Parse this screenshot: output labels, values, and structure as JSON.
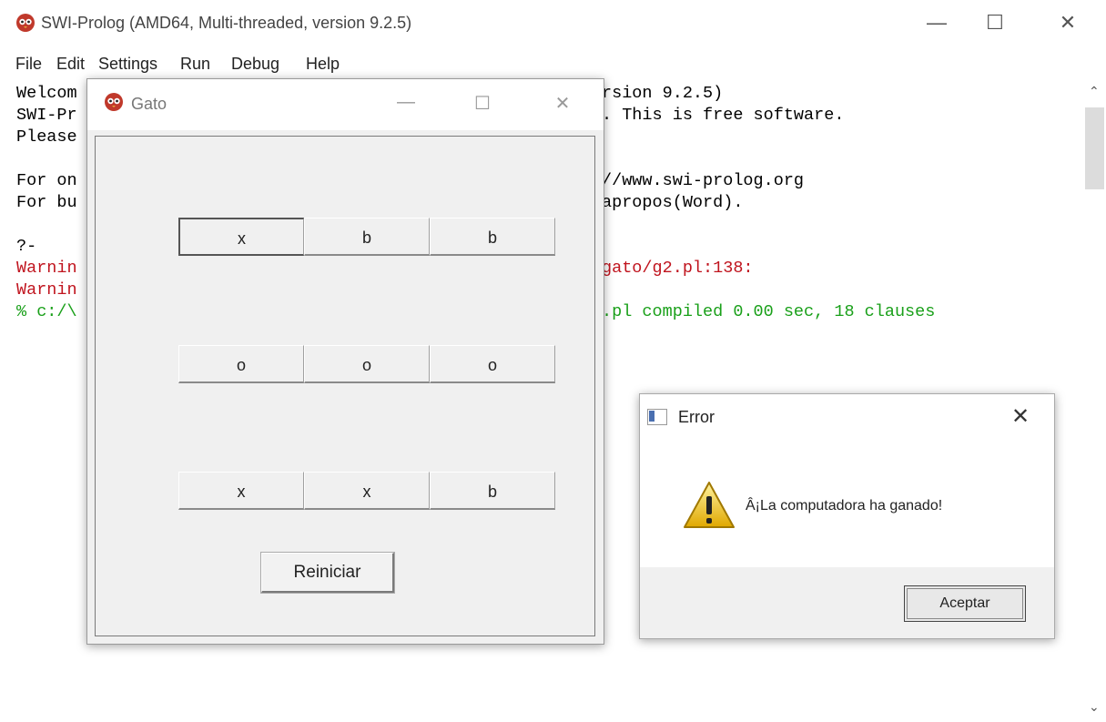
{
  "main_window": {
    "title": "SWI-Prolog (AMD64, Multi-threaded, version 9.2.5)",
    "controls": {
      "minimize": "—",
      "maximize": "☐",
      "close": "✕"
    },
    "menu": [
      "File",
      "Edit",
      "Settings",
      "Run",
      "Debug",
      "Help"
    ]
  },
  "console": {
    "line1": "Welcom",
    "line1b": "rsion 9.2.5)",
    "line2": "SWI-Pr",
    "line2b": ". This is free software.",
    "line3": "Please",
    "line4": "For on",
    "line4b": "//www.swi-prolog.org",
    "line5": "For bu",
    "line5b": "apropos(Word).",
    "line6": "?-",
    "line7": "Warnin",
    "line7b": "gato/g2.pl:138:",
    "line8": "Warnin",
    "line9": "% c:/\\",
    "line9b": ".pl compiled 0.00 sec, 18 clauses"
  },
  "gato_window": {
    "title": "Gato",
    "controls": {
      "minimize": "—",
      "maximize": "☐",
      "close": "✕"
    },
    "board": {
      "row1": [
        "x",
        "b",
        "b"
      ],
      "row2": [
        "o",
        "o",
        "o"
      ],
      "row3": [
        "x",
        "x",
        "b"
      ]
    },
    "reset_label": "Reiniciar"
  },
  "error_dialog": {
    "title": "Error",
    "close": "✕",
    "message": "Â¡La computadora ha ganado!",
    "ok_label": "Aceptar"
  }
}
